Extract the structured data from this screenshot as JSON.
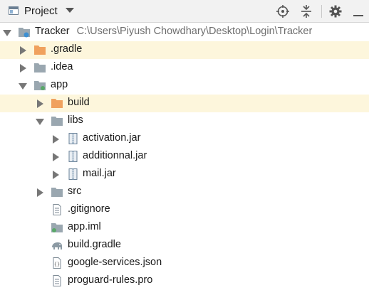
{
  "header": {
    "title": "Project",
    "icons": [
      "locate-icon",
      "collapse-all-icon",
      "settings-icon",
      "hide-icon"
    ]
  },
  "tree": {
    "root": {
      "label": "Tracker",
      "path": "C:\\Users\\Piyush Chowdhary\\Desktop\\Login\\Tracker"
    },
    "gradle_folder": ".gradle",
    "idea_folder": ".idea",
    "app_module": "app",
    "build_folder": "build",
    "libs_folder": "libs",
    "activation_jar": "activation.jar",
    "additionnal_jar": "additionnal.jar",
    "mail_jar": "mail.jar",
    "src_folder": "src",
    "gitignore_file": ".gitignore",
    "app_iml_file": "app.iml",
    "build_gradle_file": "build.gradle",
    "google_services_file": "google-services.json",
    "proguard_file": "proguard-rules.pro"
  },
  "colors": {
    "highlight_row": "#fdf6dc",
    "excluded_folder": "#f0a15e",
    "folder": "#9aa7b0",
    "module_badge": "#59a869"
  }
}
